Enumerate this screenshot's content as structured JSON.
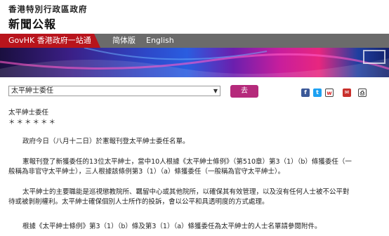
{
  "header": {
    "department": "香港特別行政區政府",
    "site_title": "新聞公報"
  },
  "nav": {
    "govhk": "GovHK 香港政府一站通",
    "simplified": "简体版",
    "english": "English"
  },
  "toolbar": {
    "select_value": "太平紳士委任",
    "go_label": "去"
  },
  "share": {
    "facebook": "f",
    "twitter": "t",
    "weibo": "w",
    "email": "✉",
    "print": "⎙"
  },
  "article": {
    "title": "太平紳士委任",
    "stars": "＊＊＊＊＊＊",
    "para1": "政府今日（八月十二日）於憲報刊登太平紳士委任名單。",
    "para2a": "憲報刊登了新獲委任的13位太平紳士，當中10人根據《太平紳士條例》（第510章）第3（1）（b）條獲委任（一",
    "para2b": "般稱為非官守太平紳士），三人根據該條例第3（1）（a）條獲委任（一般稱為官守太平紳士）。",
    "para3a": "太平紳士的主要職能是巡視懲教院所、羈留中心或其他院所，以確保其有效管理，以及沒有任何人士被不公平對",
    "para3b": "待或被剝削權利。太平紳士確保個別人士所作的投訴，會以公平和具透明度的方式處理。",
    "para4": "根據《太平紳士條例》第3（1）（b）條及第3（1）（a）條獲委任為太平紳士的人士名單請參閱附件。"
  }
}
